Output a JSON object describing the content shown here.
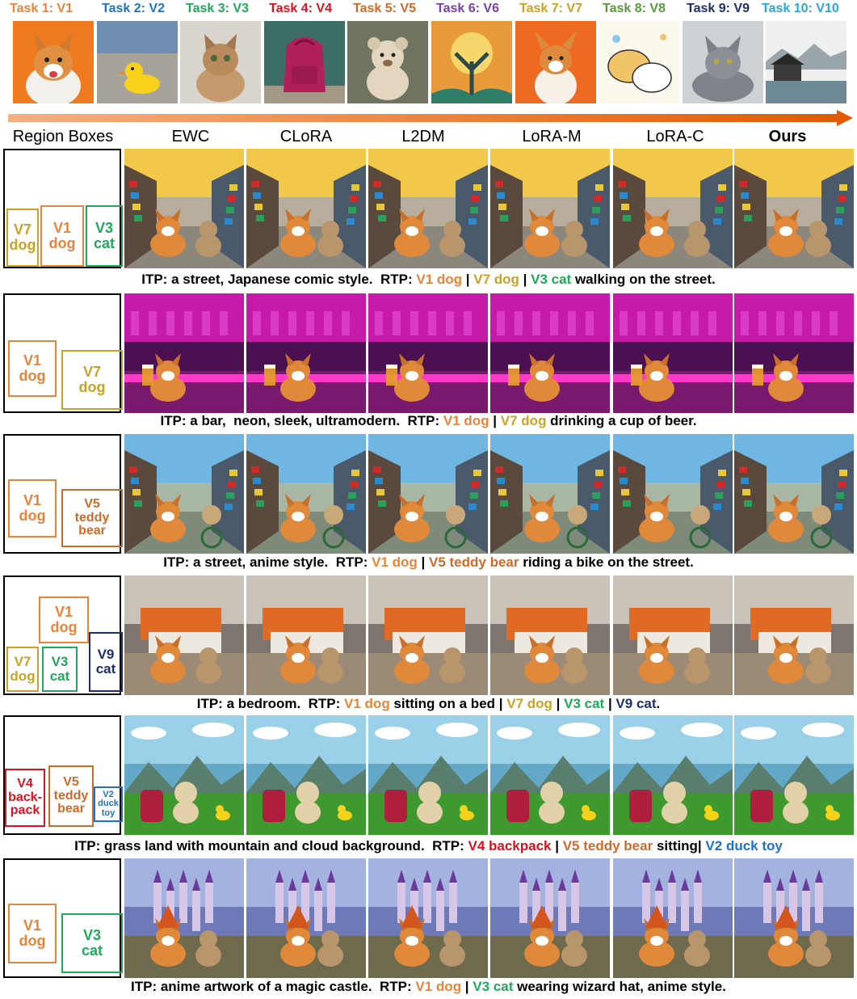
{
  "tasks": [
    {
      "label": "Task 1: V1",
      "color": "#E8843A",
      "subject": "corgi dog on orange background"
    },
    {
      "label": "Task 2: V2",
      "color": "#1E72C8",
      "subject": "yellow rubber duck on beach"
    },
    {
      "label": "Task 3: V3",
      "color": "#1FA95A",
      "subject": "fluffy kitten"
    },
    {
      "label": "Task 4: V4",
      "color": "#E0101E",
      "subject": "red backpack"
    },
    {
      "label": "Task 5: V5",
      "color": "#D06A2A",
      "subject": "teddy bear"
    },
    {
      "label": "Task 6: V6",
      "color": "#7A3FA8",
      "subject": "ornate tree artwork"
    },
    {
      "label": "Task 7: V7",
      "color": "#C9A227",
      "subject": "corgi puppy on orange"
    },
    {
      "label": "Task 8: V8",
      "color": "#5A9A3A",
      "subject": "sketched dogs"
    },
    {
      "label": "Task 9: V9",
      "color": "#1B2F6E",
      "subject": "grey cat"
    },
    {
      "label": "Task 10: V10",
      "color": "#2AA8D8",
      "subject": "Chinese ink landscape"
    }
  ],
  "methods": [
    "Region Boxes",
    "EWC",
    "CLoRA",
    "L2DM",
    "LoRA-M",
    "LoRA-C",
    "Ours"
  ],
  "rows": [
    {
      "boxes": [
        {
          "text": [
            "V7",
            "dog"
          ],
          "color": "#C9A227"
        },
        {
          "text": [
            "V1",
            "dog"
          ],
          "color": "#E8843A"
        },
        {
          "text": [
            "V3",
            "cat"
          ],
          "color": "#1FA95A"
        }
      ],
      "caption": [
        {
          "t": "ITP: a street, Japanese comic style.  RTP: ",
          "c": ""
        },
        {
          "t": "V1 dog",
          "c": "c-orange"
        },
        {
          "t": " | ",
          "c": ""
        },
        {
          "t": "V7 dog",
          "c": "c-gold"
        },
        {
          "t": " | ",
          "c": ""
        },
        {
          "t": "V3 cat",
          "c": "c-green"
        },
        {
          "t": " walking on the street.",
          "c": ""
        }
      ],
      "scene": "street"
    },
    {
      "boxes": [
        {
          "text": [
            "V1",
            "dog"
          ],
          "color": "#E8843A"
        },
        {
          "text": [
            "V7",
            "dog"
          ],
          "color": "#C9A227"
        }
      ],
      "caption": [
        {
          "t": "ITP: a bar,  neon, sleek, ultramodern.  RTP: ",
          "c": ""
        },
        {
          "t": "V1 dog",
          "c": "c-orange"
        },
        {
          "t": " | ",
          "c": ""
        },
        {
          "t": "V7 dog",
          "c": "c-gold"
        },
        {
          "t": " drinking a cup of beer.",
          "c": ""
        }
      ],
      "scene": "bar"
    },
    {
      "boxes": [
        {
          "text": [
            "V1",
            "dog"
          ],
          "color": "#E8843A"
        },
        {
          "text": [
            "V5",
            "teddy",
            "bear"
          ],
          "color": "#D06A2A"
        }
      ],
      "caption": [
        {
          "t": "ITP: a street, anime style.  RTP: ",
          "c": ""
        },
        {
          "t": "V1 dog",
          "c": "c-orange"
        },
        {
          "t": " | ",
          "c": ""
        },
        {
          "t": "V5 teddy bear",
          "c": "c-brown"
        },
        {
          "t": " riding a bike on the street.",
          "c": ""
        }
      ],
      "scene": "anime"
    },
    {
      "boxes": [
        {
          "text": [
            "V1",
            "dog"
          ],
          "color": "#E8843A"
        },
        {
          "text": [
            "V7",
            "dog"
          ],
          "color": "#C9A227"
        },
        {
          "text": [
            "V3",
            "cat"
          ],
          "color": "#1FA95A"
        },
        {
          "text": [
            "V9",
            "cat"
          ],
          "color": "#1B2F6E"
        }
      ],
      "caption": [
        {
          "t": "ITP: a bedroom.  RTP: ",
          "c": ""
        },
        {
          "t": "V1 dog",
          "c": "c-orange"
        },
        {
          "t": " sitting on a bed | ",
          "c": ""
        },
        {
          "t": "V7 dog",
          "c": "c-gold"
        },
        {
          "t": " | ",
          "c": ""
        },
        {
          "t": "V3 cat",
          "c": "c-green"
        },
        {
          "t": " | ",
          "c": ""
        },
        {
          "t": "V9 cat",
          "c": "c-navy"
        },
        {
          "t": ".",
          "c": ""
        }
      ],
      "scene": "bedroom"
    },
    {
      "boxes": [
        {
          "text": [
            "V4",
            "back-",
            "pack"
          ],
          "color": "#E0101E"
        },
        {
          "text": [
            "V5",
            "teddy",
            "bear"
          ],
          "color": "#D06A2A"
        },
        {
          "text": [
            "V2",
            "duck",
            "toy"
          ],
          "color": "#1E72C8"
        }
      ],
      "caption": [
        {
          "t": "ITP: grass land with mountain and cloud background.  RTP: ",
          "c": ""
        },
        {
          "t": "V4 backpack",
          "c": "c-red"
        },
        {
          "t": " | ",
          "c": ""
        },
        {
          "t": "V5 teddy bear",
          "c": "c-brown"
        },
        {
          "t": " sitting| ",
          "c": ""
        },
        {
          "t": "V2 duck toy",
          "c": "c-blue"
        }
      ],
      "scene": "grass"
    },
    {
      "boxes": [
        {
          "text": [
            "V1",
            "dog"
          ],
          "color": "#E8843A"
        },
        {
          "text": [
            "V3",
            "cat"
          ],
          "color": "#1FA95A"
        }
      ],
      "caption": [
        {
          "t": "ITP: anime artwork of a magic castle.  RTP: ",
          "c": ""
        },
        {
          "t": "V1 dog",
          "c": "c-orange"
        },
        {
          "t": " | ",
          "c": ""
        },
        {
          "t": "V3 cat",
          "c": "c-green"
        },
        {
          "t": " wearing wizard hat, anime style.",
          "c": ""
        }
      ],
      "scene": "castle"
    }
  ]
}
